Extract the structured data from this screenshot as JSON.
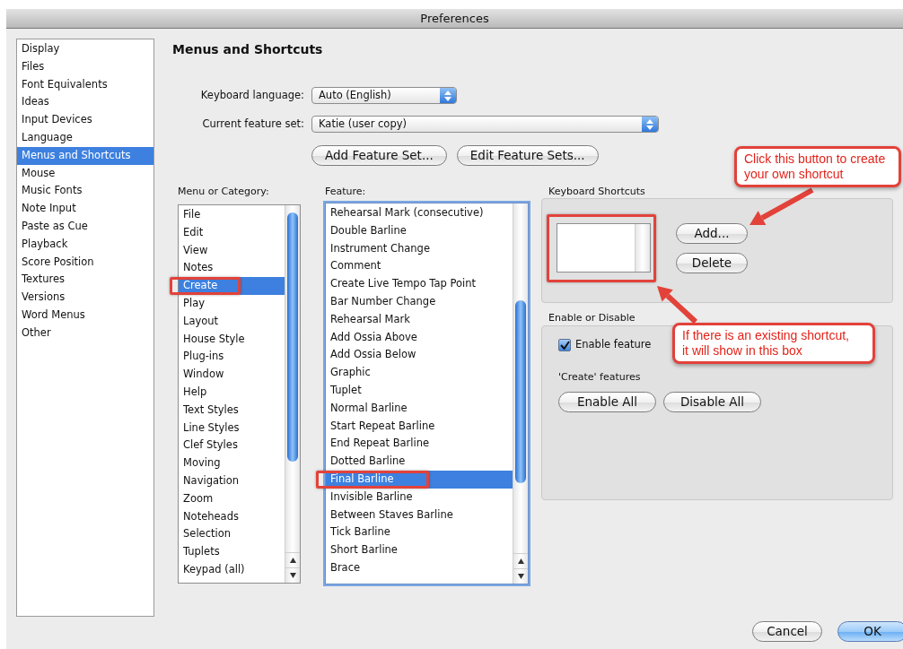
{
  "window": {
    "title": "Preferences"
  },
  "sidebar": {
    "items": [
      {
        "label": "Display",
        "selected": false
      },
      {
        "label": "Files",
        "selected": false
      },
      {
        "label": "Font Equivalents",
        "selected": false
      },
      {
        "label": "Ideas",
        "selected": false
      },
      {
        "label": "Input Devices",
        "selected": false
      },
      {
        "label": "Language",
        "selected": false
      },
      {
        "label": "Menus and Shortcuts",
        "selected": true
      },
      {
        "label": "Mouse",
        "selected": false
      },
      {
        "label": "Music Fonts",
        "selected": false
      },
      {
        "label": "Note Input",
        "selected": false
      },
      {
        "label": "Paste as Cue",
        "selected": false
      },
      {
        "label": "Playback",
        "selected": false
      },
      {
        "label": "Score Position",
        "selected": false
      },
      {
        "label": "Textures",
        "selected": false
      },
      {
        "label": "Versions",
        "selected": false
      },
      {
        "label": "Word Menus",
        "selected": false
      },
      {
        "label": "Other",
        "selected": false
      }
    ]
  },
  "page": {
    "title": "Menus and Shortcuts"
  },
  "keyboard_language": {
    "label": "Keyboard language:",
    "value": "Auto (English)"
  },
  "feature_set": {
    "label": "Current feature set:",
    "value": "Katie (user copy)"
  },
  "feature_set_buttons": [
    "Add Feature Set...",
    "Edit Feature Sets..."
  ],
  "category_list": {
    "label": "Menu or Category:",
    "items": [
      {
        "label": "File",
        "selected": false,
        "highlighted": false
      },
      {
        "label": "Edit",
        "selected": false,
        "highlighted": false
      },
      {
        "label": "View",
        "selected": false,
        "highlighted": false
      },
      {
        "label": "Notes",
        "selected": false,
        "highlighted": false
      },
      {
        "label": "Create",
        "selected": true,
        "highlighted": true
      },
      {
        "label": "Play",
        "selected": false,
        "highlighted": false
      },
      {
        "label": "Layout",
        "selected": false,
        "highlighted": false
      },
      {
        "label": "House Style",
        "selected": false,
        "highlighted": false
      },
      {
        "label": "Plug-ins",
        "selected": false,
        "highlighted": false
      },
      {
        "label": "Window",
        "selected": false,
        "highlighted": false
      },
      {
        "label": "Help",
        "selected": false,
        "highlighted": false
      },
      {
        "label": "Text Styles",
        "selected": false,
        "highlighted": false
      },
      {
        "label": "Line Styles",
        "selected": false,
        "highlighted": false
      },
      {
        "label": "Clef Styles",
        "selected": false,
        "highlighted": false
      },
      {
        "label": "Moving",
        "selected": false,
        "highlighted": false
      },
      {
        "label": "Navigation",
        "selected": false,
        "highlighted": false
      },
      {
        "label": "Zoom",
        "selected": false,
        "highlighted": false
      },
      {
        "label": "Noteheads",
        "selected": false,
        "highlighted": false
      },
      {
        "label": "Selection",
        "selected": false,
        "highlighted": false
      },
      {
        "label": "Tuplets",
        "selected": false,
        "highlighted": false
      },
      {
        "label": "Keypad (all)",
        "selected": false,
        "highlighted": false
      }
    ]
  },
  "feature_list": {
    "label": "Feature:",
    "items": [
      {
        "label": "Rehearsal Mark (consecutive)",
        "selected": false,
        "highlighted": false
      },
      {
        "label": "Double Barline",
        "selected": false,
        "highlighted": false
      },
      {
        "label": "Instrument Change",
        "selected": false,
        "highlighted": false
      },
      {
        "label": "Comment",
        "selected": false,
        "highlighted": false
      },
      {
        "label": "Create Live Tempo Tap Point",
        "selected": false,
        "highlighted": false
      },
      {
        "label": "Bar Number Change",
        "selected": false,
        "highlighted": false
      },
      {
        "label": "Rehearsal Mark",
        "selected": false,
        "highlighted": false
      },
      {
        "label": "Add Ossia Above",
        "selected": false,
        "highlighted": false
      },
      {
        "label": "Add Ossia Below",
        "selected": false,
        "highlighted": false
      },
      {
        "label": "Graphic",
        "selected": false,
        "highlighted": false
      },
      {
        "label": "Tuplet",
        "selected": false,
        "highlighted": false
      },
      {
        "label": "Normal Barline",
        "selected": false,
        "highlighted": false
      },
      {
        "label": "Start Repeat Barline",
        "selected": false,
        "highlighted": false
      },
      {
        "label": "End Repeat Barline",
        "selected": false,
        "highlighted": false
      },
      {
        "label": "Dotted Barline",
        "selected": false,
        "highlighted": false
      },
      {
        "label": "Final Barline",
        "selected": true,
        "highlighted": true
      },
      {
        "label": "Invisible Barline",
        "selected": false,
        "highlighted": false
      },
      {
        "label": "Between Staves Barline",
        "selected": false,
        "highlighted": false
      },
      {
        "label": "Tick Barline",
        "selected": false,
        "highlighted": false
      },
      {
        "label": "Short Barline",
        "selected": false,
        "highlighted": false
      },
      {
        "label": "Brace",
        "selected": false,
        "highlighted": false
      }
    ]
  },
  "keyboard_shortcuts": {
    "label": "Keyboard Shortcuts",
    "highlighted": true,
    "buttons": [
      "Add...",
      "Delete"
    ]
  },
  "enable_or_disable": {
    "label": "Enable or Disable",
    "enable_feature": {
      "label": "Enable feature",
      "checked": true
    },
    "features_label": "'Create' features",
    "buttons": [
      "Enable All",
      "Disable All"
    ]
  },
  "dialog_buttons": [
    {
      "label": "Cancel",
      "default": false
    },
    {
      "label": "OK",
      "default": true
    }
  ],
  "annotations": [
    {
      "text": "Click this button to create\nyour own shortcut"
    },
    {
      "text": "If there is an existing shortcut,\nit will show in this box"
    }
  ]
}
